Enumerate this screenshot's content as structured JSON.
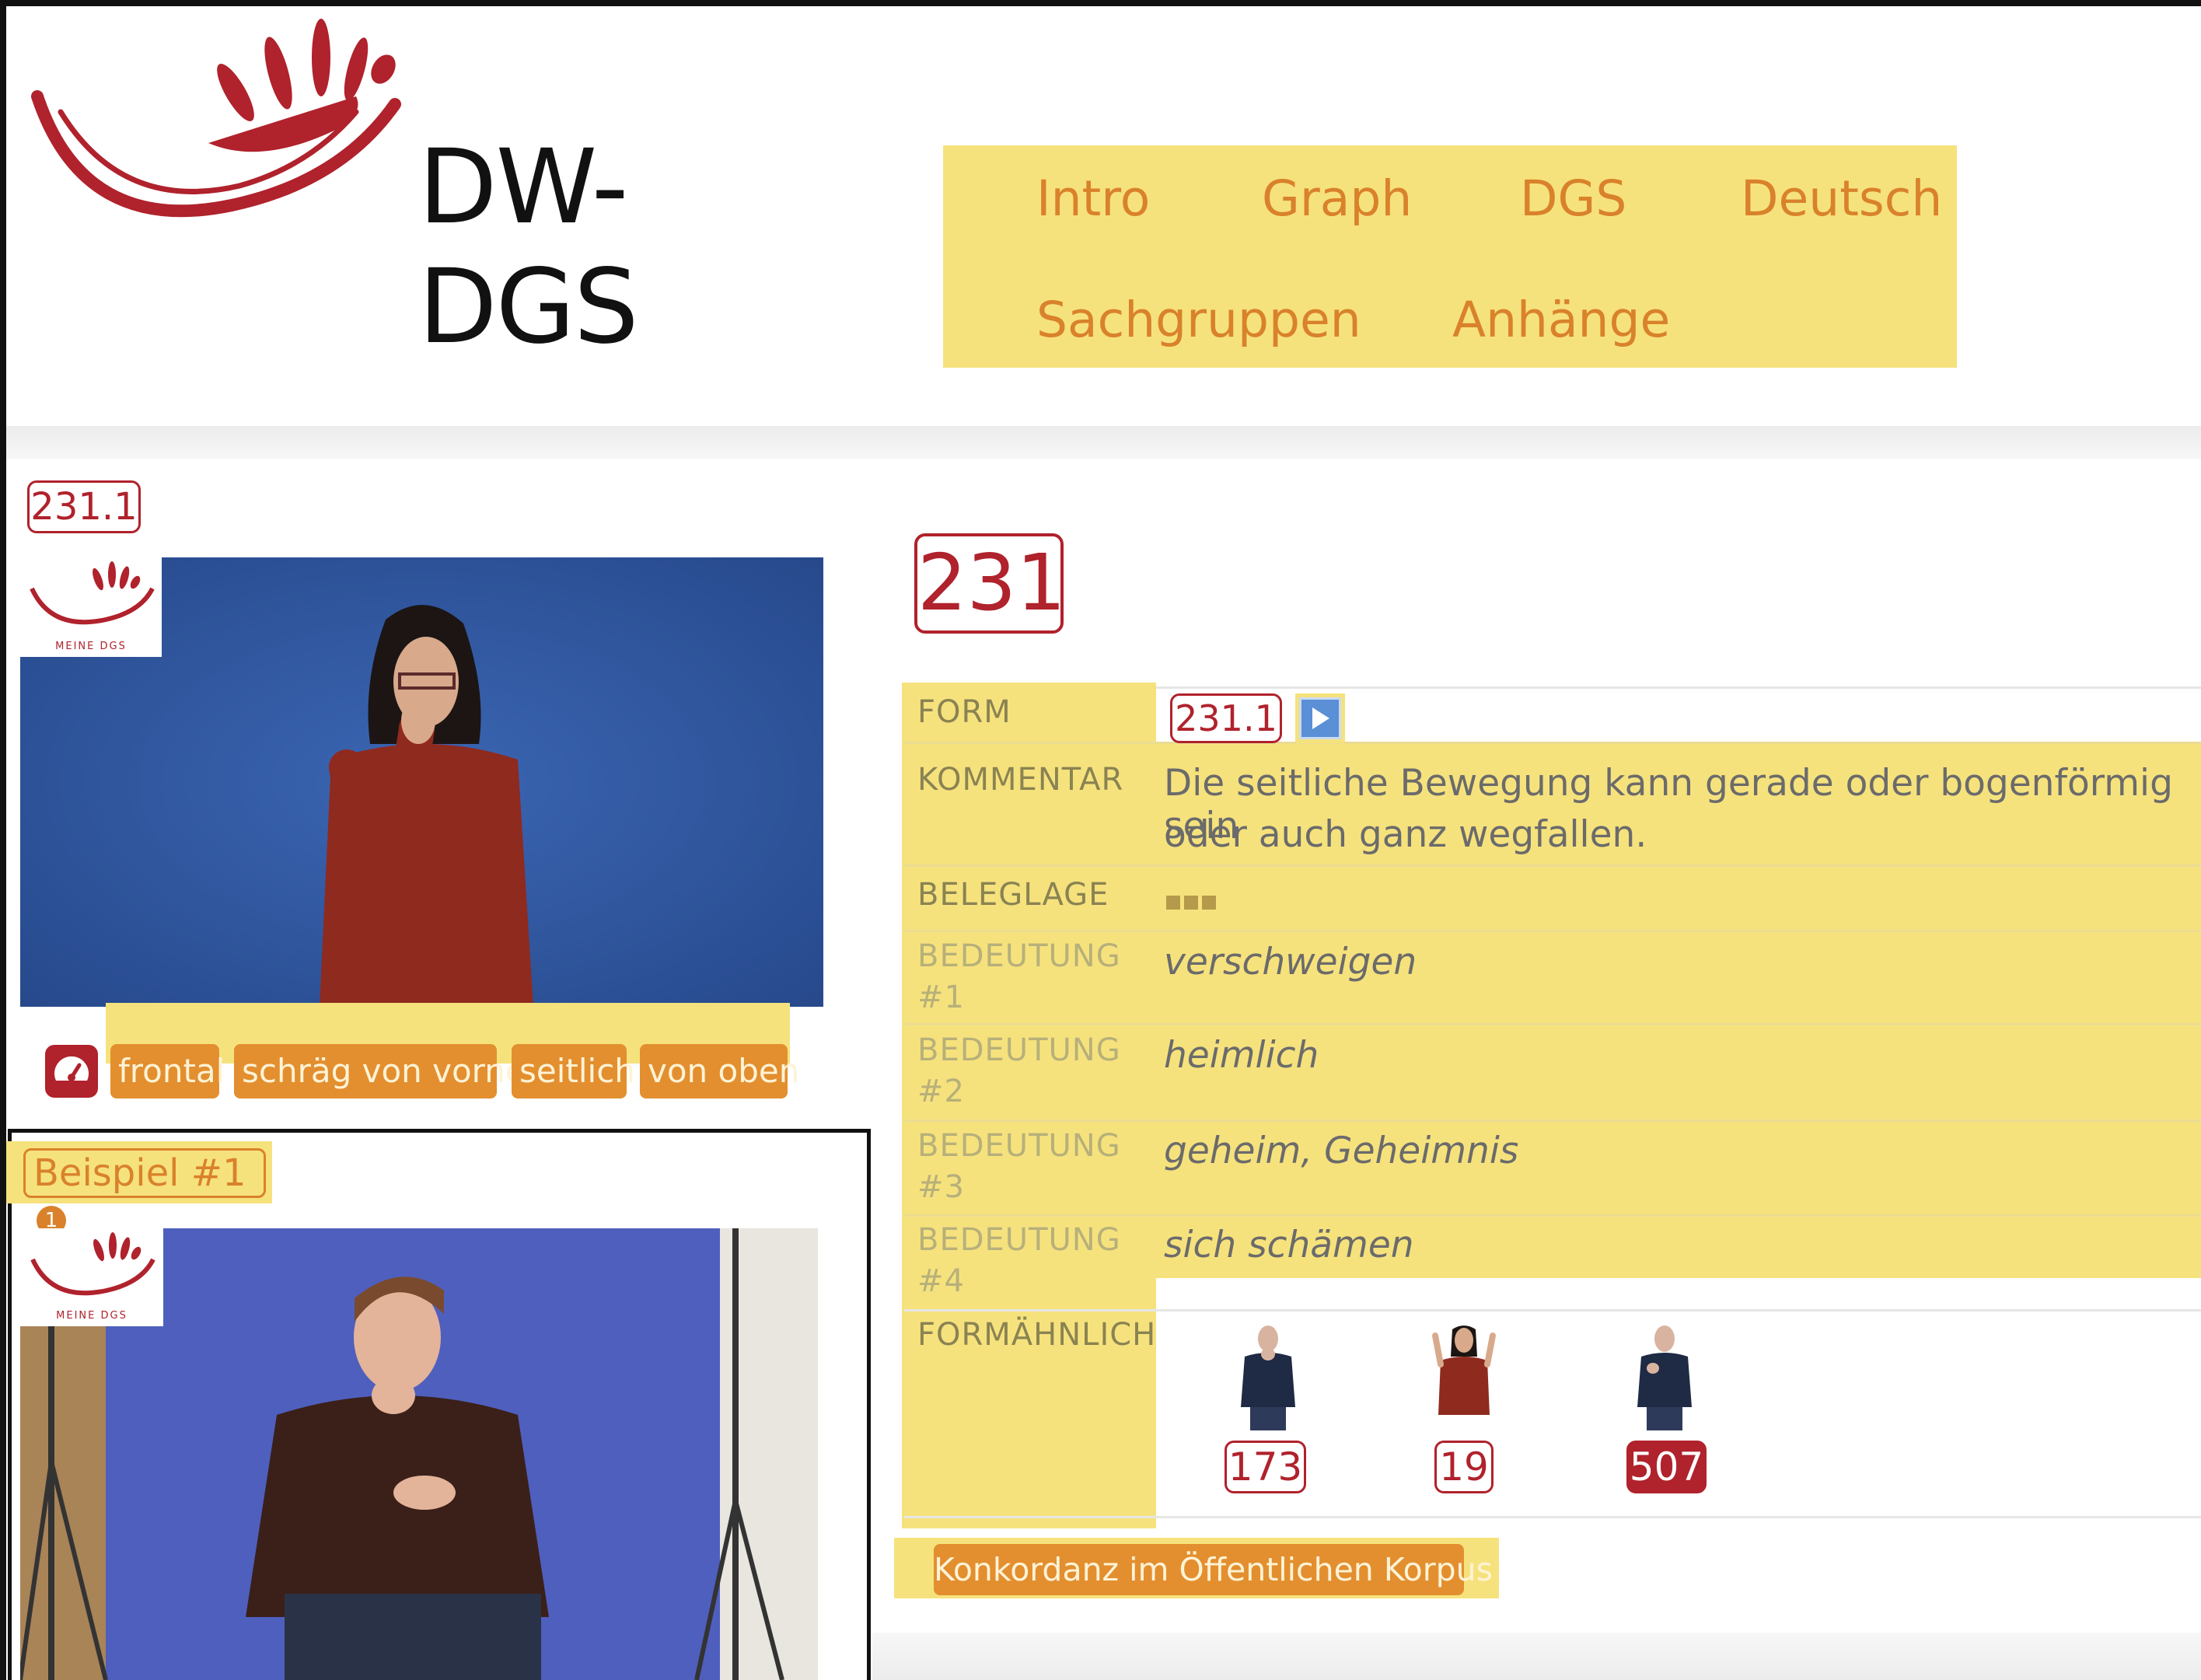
{
  "brand": {
    "name": "DW-DGS",
    "video_logo_caption": "MEINE DGS"
  },
  "nav": {
    "items": [
      "Intro",
      "Graph",
      "DGS",
      "Deutsch",
      "Sachgruppen",
      "Anhänge"
    ]
  },
  "left": {
    "form_id": "231.1",
    "perspectives": [
      "frontal",
      "schräg von vorne",
      "seitlich",
      "von oben"
    ],
    "example_label": "Beispiel #1",
    "example_info": "1"
  },
  "entry": {
    "number": "231",
    "rows": {
      "form": {
        "label": "FORM",
        "value": "231.1"
      },
      "kommentar": {
        "label": "KOMMENTAR",
        "line1": "Die seitliche Bewegung kann gerade oder bogenförmig sein",
        "line2": "oder auch ganz wegfallen."
      },
      "beleglage": {
        "label": "BELEGLAGE",
        "level": 3
      },
      "bedeutungen": [
        {
          "label_a": "BEDEUTUNG",
          "label_b": "#1",
          "value": "verschweigen"
        },
        {
          "label_a": "BEDEUTUNG",
          "label_b": "#2",
          "value": "heimlich"
        },
        {
          "label_a": "BEDEUTUNG",
          "label_b": "#3",
          "value": "geheim, Geheimnis"
        },
        {
          "label_a": "BEDEUTUNG",
          "label_b": "#4",
          "value": "sich schämen"
        }
      ],
      "formaehnlich": {
        "label": "FORMÄHNLICH",
        "items": [
          "173",
          "19",
          "507"
        ]
      }
    },
    "konkordanz": "Konkordanz im Öffentlichen Korpus"
  },
  "colors": {
    "brand_red": "#b0222c",
    "highlight_yellow": "#f6e27d",
    "button_orange": "#e38f2f",
    "video_blue": "#2f5aa5"
  }
}
